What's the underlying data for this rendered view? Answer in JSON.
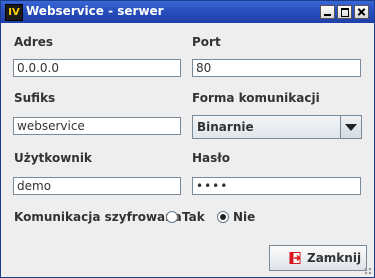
{
  "window": {
    "title": "Webservice - serwer",
    "app_icon_text": "IV"
  },
  "form": {
    "adres": {
      "label": "Adres",
      "value": "0.0.0.0"
    },
    "port": {
      "label": "Port",
      "value": "80"
    },
    "sufiks": {
      "label": "Sufiks",
      "value": "webservice"
    },
    "forma": {
      "label": "Forma komunikacji",
      "selected": "Binarnie"
    },
    "uzytkownik": {
      "label": "Użytkownik",
      "value": "demo"
    },
    "haslo": {
      "label": "Hasło",
      "value": "••••"
    },
    "szyfrowanie": {
      "label": "Komunikacja szyfrowana",
      "options": [
        "Tak",
        "Nie"
      ],
      "selected": "Nie"
    }
  },
  "buttons": {
    "close_label": "Zamknij"
  },
  "colors": {
    "title_bar": "#2a50c0",
    "window_bg": "#eeeeee",
    "close_icon_accent": "#d8141c"
  },
  "icons": {
    "window_buttons": [
      "minimize-icon",
      "maximize-icon",
      "close-icon"
    ],
    "close_button": "exit-door-icon"
  }
}
